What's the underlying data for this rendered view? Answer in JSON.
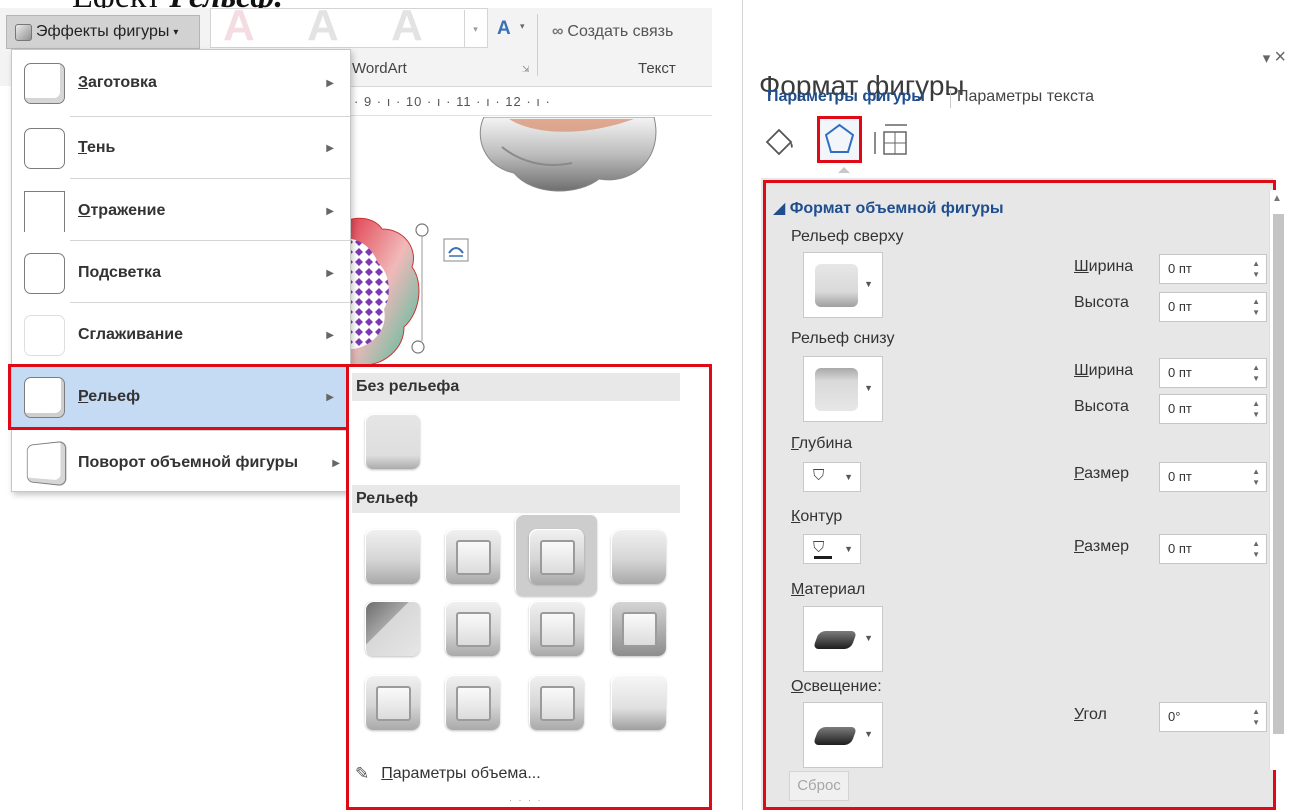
{
  "heading": {
    "prefix": "Ефект",
    "emphasis": "Рельєф."
  },
  "ribbon": {
    "effects_button": "Эффекты фигуры",
    "wordart_letter": "A",
    "wordart_label": "WordArt",
    "text_label": "Текст",
    "create_link": "Создать связь",
    "ruler": "· 9 · ı · 10 · ı · 11 · ı · 12 · ı ·"
  },
  "menu": {
    "items": [
      {
        "label": "Заготовка"
      },
      {
        "label": "Тень"
      },
      {
        "label": "Отражение"
      },
      {
        "label": "Подсветка"
      },
      {
        "label": "Сглаживание"
      },
      {
        "label": "Рельеф",
        "highlighted": true
      },
      {
        "label": "Поворот объемной фигуры"
      }
    ]
  },
  "gallery": {
    "none_header": "Без рельефа",
    "bevel_header": "Рельеф",
    "options_link": "Параметры объема...",
    "selected_index": 2
  },
  "pane": {
    "title": "Формат фигуры",
    "tab_shape": "Параметры фигуры",
    "tab_text": "Параметры текста",
    "section_title": "Формат объемной фигуры",
    "top_bevel": "Рельеф сверху",
    "bottom_bevel": "Рельеф снизу",
    "width_label": "Ширина",
    "height_label": "Высота",
    "depth": "Глубина",
    "contour": "Контур",
    "size_label": "Размер",
    "material": "Материал",
    "lighting": "Освещение:",
    "angle_label": "Угол",
    "reset": "Сброс",
    "values": {
      "top_width": "0 пт",
      "top_height": "0 пт",
      "bottom_width": "0 пт",
      "bottom_height": "0 пт",
      "depth_size": "0 пт",
      "contour_size": "0 пт",
      "angle": "0°"
    }
  }
}
